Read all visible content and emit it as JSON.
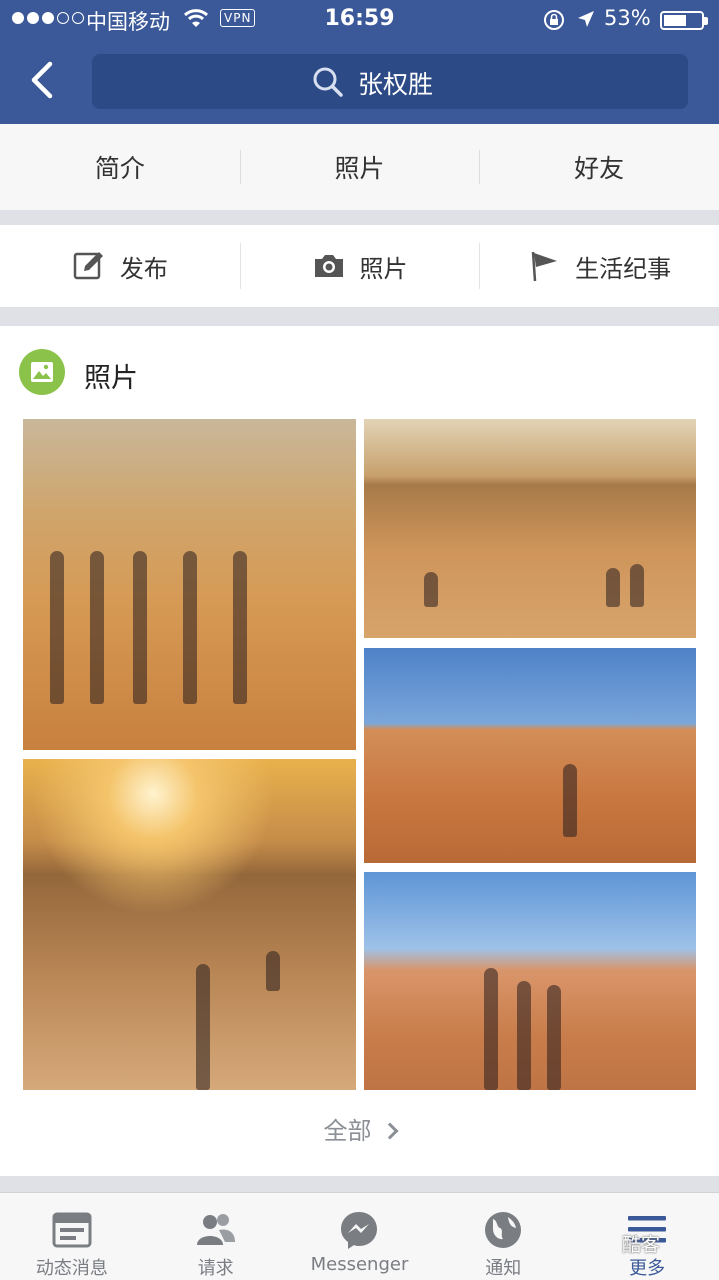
{
  "status": {
    "carrier": "中国移动",
    "vpn": "VPN",
    "time": "16:59",
    "battery": "53%"
  },
  "header": {
    "search_text": "张权胜"
  },
  "tabs": [
    "简介",
    "照片",
    "好友"
  ],
  "actions": [
    {
      "label": "发布",
      "icon": "edit-icon"
    },
    {
      "label": "照片",
      "icon": "camera-icon"
    },
    {
      "label": "生活纪事",
      "icon": "flag-icon"
    }
  ],
  "photos_section": {
    "title": "照片",
    "see_all": "全部",
    "photo_count": 5
  },
  "bottom_nav": [
    {
      "label": "动态消息",
      "icon": "news-feed-icon",
      "active": false
    },
    {
      "label": "请求",
      "icon": "friend-requests-icon",
      "active": false
    },
    {
      "label": "Messenger",
      "icon": "messenger-icon",
      "active": false
    },
    {
      "label": "通知",
      "icon": "globe-icon",
      "active": false
    },
    {
      "label": "更多",
      "icon": "menu-icon",
      "active": true
    }
  ],
  "watermark": "酷客",
  "colors": {
    "brand": "#3b5998",
    "accent_green": "#8bc34a"
  }
}
